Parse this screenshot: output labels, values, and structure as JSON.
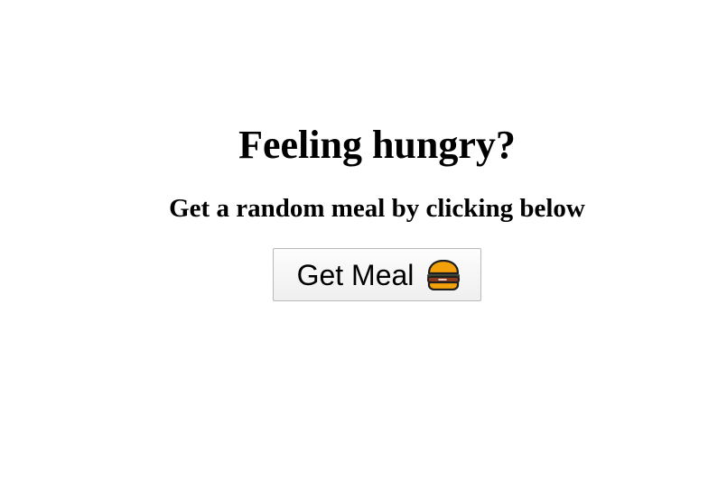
{
  "hero": {
    "title": "Feeling hungry?",
    "subtitle": "Get a random meal by clicking below"
  },
  "actions": {
    "get_meal_label": "Get Meal",
    "get_meal_icon": "hamburger-icon"
  },
  "colors": {
    "text": "#000000",
    "background": "#ffffff",
    "button_border": "#b8b8b8"
  }
}
